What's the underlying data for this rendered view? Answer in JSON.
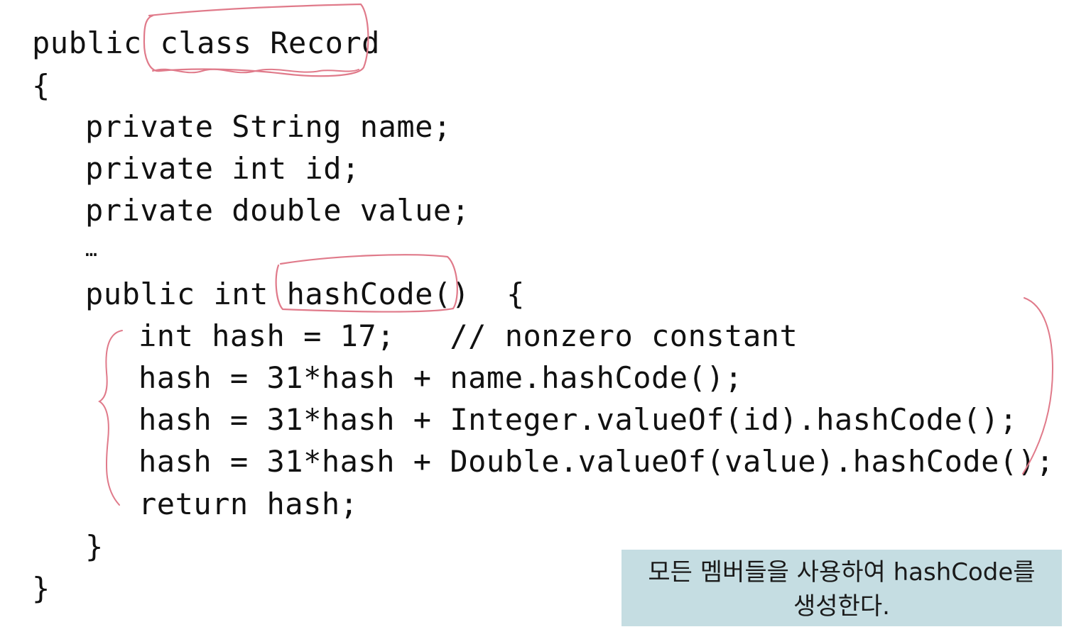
{
  "code": {
    "lines": [
      "public class Record",
      "{",
      "private String name;",
      "private int id;",
      "private double value;",
      "…",
      "public int hashCode()  {",
      "int hash = 17;   // nonzero constant",
      "hash = 31*hash + name.hashCode();",
      "hash = 31*hash + Integer.valueOf(id).hashCode();",
      "hash = 31*hash + Double.valueOf(value).hashCode();",
      "return hash;",
      "}",
      "}"
    ]
  },
  "note": {
    "text": "모든 멤버들을 사용하여 hashCode를 생성한다."
  },
  "colors": {
    "code_text": "#111111",
    "annotation_ink": "#e07a8a",
    "note_background": "#c5dde2"
  }
}
